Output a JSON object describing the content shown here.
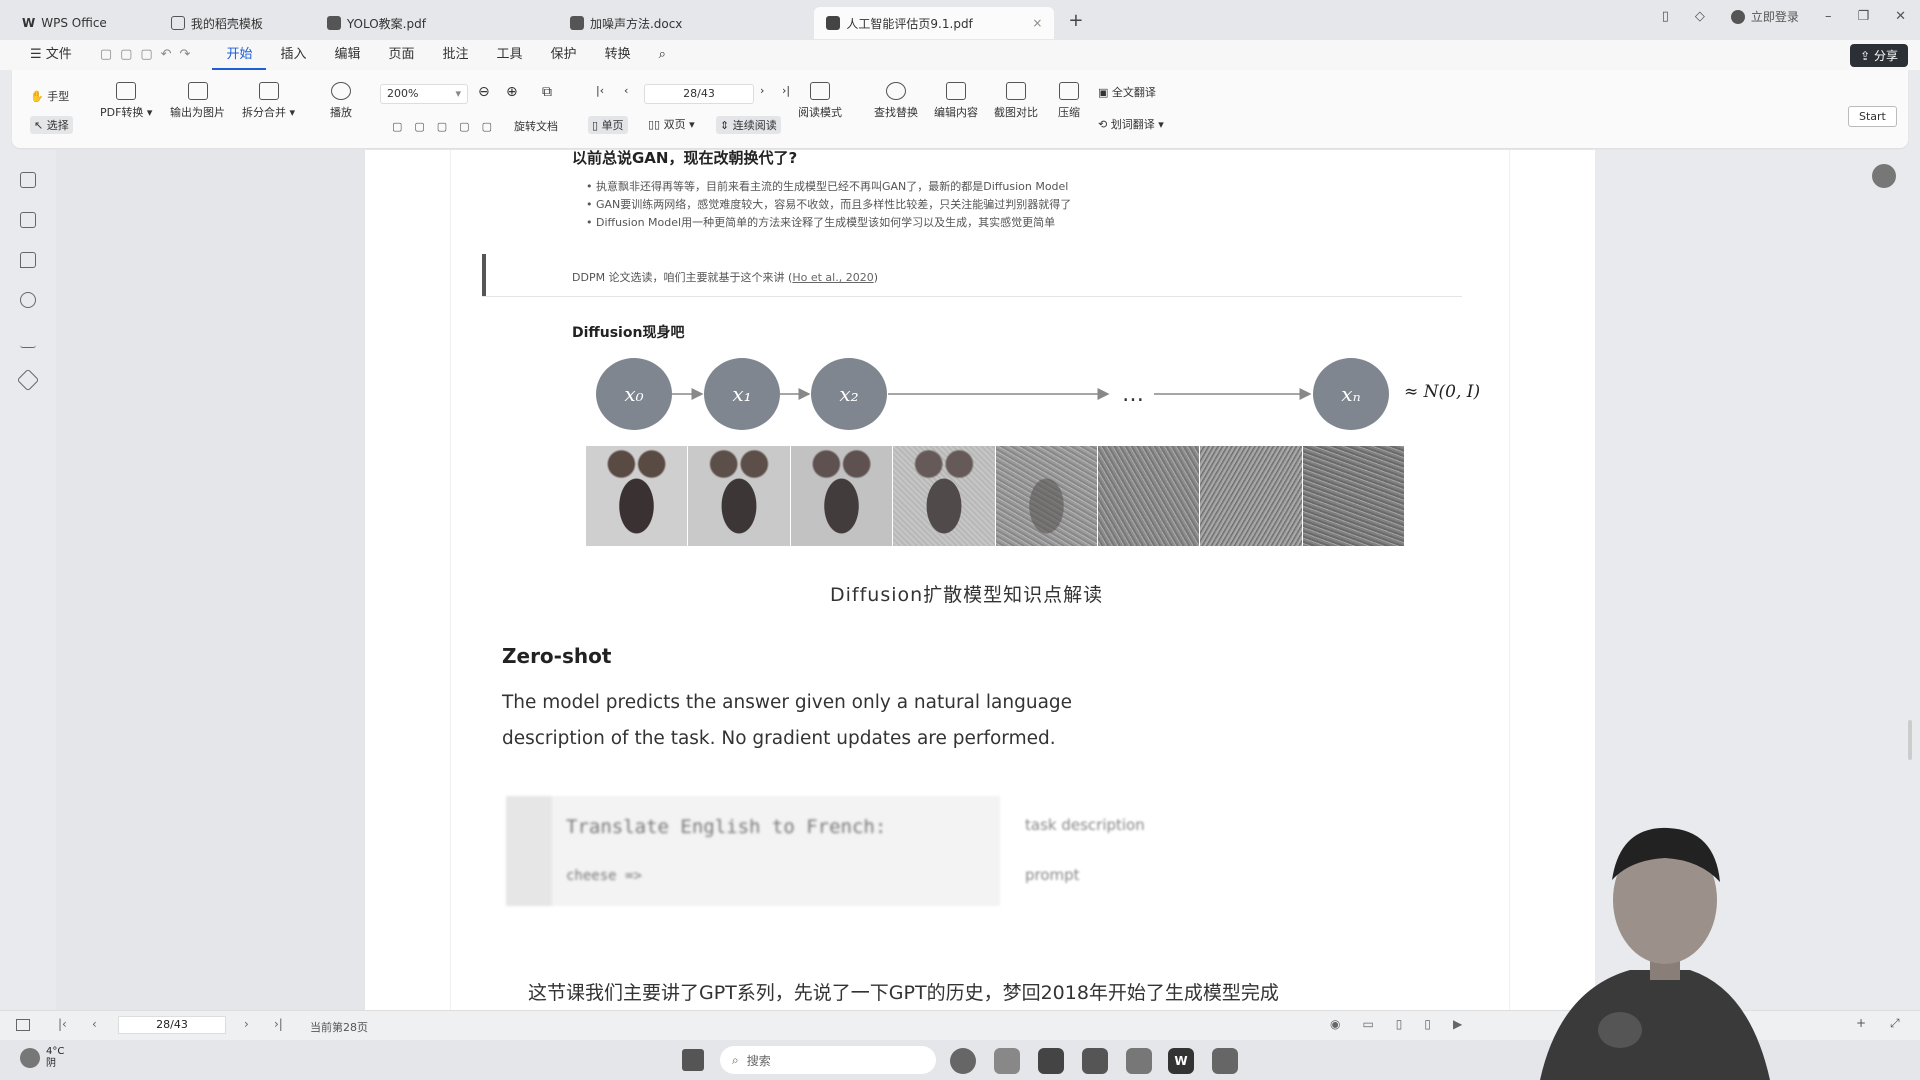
{
  "titlebar": {
    "tabs": [
      {
        "label": "WPS Office"
      },
      {
        "label": "我的稻壳模板"
      },
      {
        "label": "YOLO教案.pdf"
      },
      {
        "label": "加噪声方法.docx"
      },
      {
        "label": "人工智能评估页9.1.pdf"
      }
    ],
    "login": "立即登录"
  },
  "menubar": {
    "file": "文件",
    "items": [
      "开始",
      "插入",
      "编辑",
      "页面",
      "批注",
      "工具",
      "保护",
      "转换"
    ],
    "share": "分享"
  },
  "ribbon": {
    "hand": "手型",
    "select": "选择",
    "pdf_convert": "PDF转换",
    "export_image": "输出为图片",
    "split_merge": "拆分合并",
    "play": "播放",
    "zoom": "200%",
    "page": "28/43",
    "rotate": "旋转文档",
    "single": "单页",
    "double": "双页",
    "continuous": "连续阅读",
    "read_mode": "阅读模式",
    "find": "查找替换",
    "edit_content": "编辑内容",
    "compare": "截图对比",
    "compress": "压缩",
    "translate_full": "全文翻译",
    "translate_word": "划词翻译",
    "start": "Start"
  },
  "doc": {
    "heading1": "以前总说GAN，现在改朝换代了?",
    "bullets": [
      "执意飘非还得再等等，目前来看主流的生成模型已经不再叫GAN了，最新的都是Diffusion Model",
      "GAN要训练两网络，感觉难度较大，容易不收敛，而且多样性比较差，只关注能骗过判别器就得了",
      "Diffusion Model用一种更简单的方法来诠释了生成模型该如何学习以及生成，其实感觉更简单"
    ],
    "quote": "DDPM 论文选读，咱们主要就基于这个来讲",
    "quote_link": "Ho et al., 2020",
    "heading2": "Diffusion现身吧",
    "nodes": [
      "x₀",
      "x₁",
      "x₂",
      "…",
      "xₙ"
    ],
    "normal": "≈ N(0, I)",
    "caption": "Diffusion扩散模型知识点解读",
    "zeroshot_title": "Zero-shot",
    "zeroshot_line1": "The model predicts the answer given only a natural language",
    "zeroshot_line2": "description of the task. No gradient updates are performed.",
    "zs_task": "Translate English to French:",
    "zs_task_label": "task description",
    "zs_prompt": "cheese =>",
    "zs_prompt_label": "prompt",
    "subtitle": "这节课我们主要讲了GPT系列，先说了一下GPT的历史，梦回2018年开始了生成模型完成"
  },
  "status": {
    "page": "28/43",
    "current": "当前第28页"
  },
  "taskbar": {
    "weather_temp": "4°C",
    "weather_text": "阴",
    "search": "搜索"
  }
}
